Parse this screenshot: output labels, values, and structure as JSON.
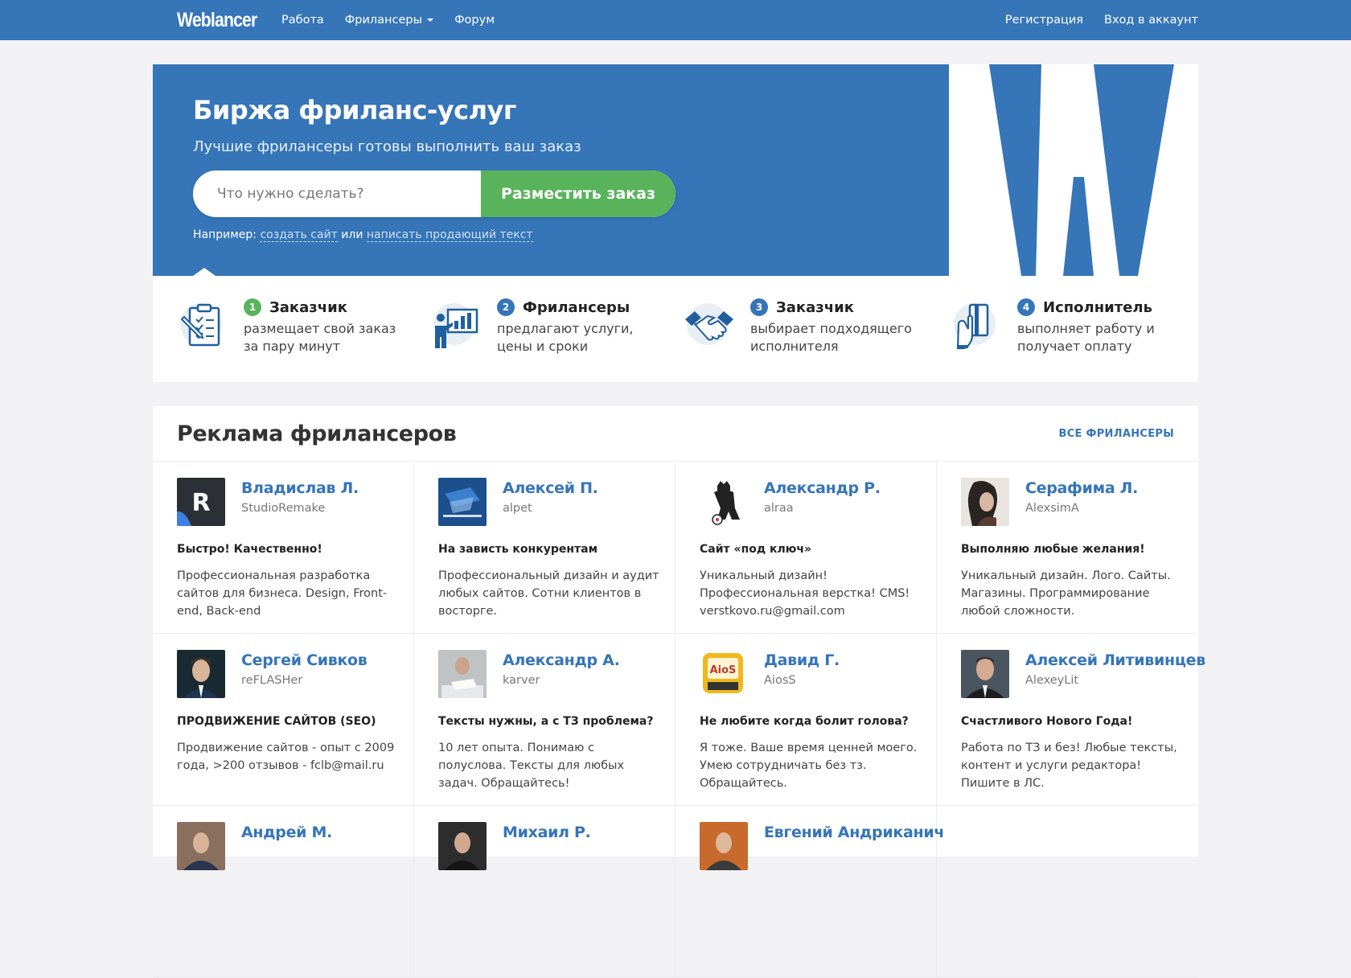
{
  "nav": {
    "logo": "Weblancer",
    "links": [
      "Работа",
      "Фрилансеры",
      "Форум"
    ],
    "register": "Регистрация",
    "login": "Вход в аккаунт"
  },
  "hero": {
    "title": "Биржа фриланс-услуг",
    "subtitle": "Лучшие фрилансеры готовы выполнить ваш заказ",
    "search_placeholder": "Что нужно сделать?",
    "button": "Разместить заказ",
    "example_prefix": "Например:",
    "example_link1": "создать сайт",
    "example_or": "или",
    "example_link2": "написать продающий текст"
  },
  "steps": [
    {
      "num": "1",
      "title": "Заказчик",
      "desc": "размещает свой заказ за пару минут",
      "badge_color": "#58b35a",
      "icon": "checklist-icon"
    },
    {
      "num": "2",
      "title": "Фрилансеры",
      "desc": "предлагают услуги, цены и сроки",
      "badge_color": "#3575b8",
      "icon": "presentation-icon"
    },
    {
      "num": "3",
      "title": "Заказчик",
      "desc": "выбирает подходящего исполнителя",
      "badge_color": "#3575b8",
      "icon": "handshake-icon"
    },
    {
      "num": "4",
      "title": "Исполнитель",
      "desc": "выполняет работу и получает оплату",
      "badge_color": "#3575b8",
      "icon": "card-payment-icon"
    }
  ],
  "ads": {
    "title": "Реклама фрилансеров",
    "all_link": "ВСЕ ФРИЛАНСЕРЫ",
    "cards": [
      {
        "name": "Владислав Л.",
        "login": "StudioRemake",
        "headline": "Быстро! Качественно!",
        "desc": "Профессиональная разработка сайтов для бизнеса. Design, Front-end, Back-end"
      },
      {
        "name": "Алексей П.",
        "login": "alpet",
        "headline": "На зависть конкурентам",
        "desc": "Профессиональный дизайн и аудит любых сайтов. Сотни клиентов в восторге."
      },
      {
        "name": "Александр Р.",
        "login": "alraa",
        "headline": "Сайт «под ключ»",
        "desc": "Уникальный дизайн! Профессиональная верстка! CMS! verstkovo.ru@gmail.com"
      },
      {
        "name": "Серафима Л.",
        "login": "AlexsimA",
        "headline": "Выполняю любые желания!",
        "desc": "Уникальный дизайн. Лого. Сайты. Магазины. Программирование любой сложности."
      },
      {
        "name": "Сергей Сивков",
        "login": "reFLASHer",
        "headline": "ПРОДВИЖЕНИЕ САЙТОВ (SEO)",
        "desc": "Продвижение сайтов - опыт с 2009 года, >200 отзывов - fclb@mail.ru"
      },
      {
        "name": "Александр А.",
        "login": "karver",
        "headline": "Тексты нужны, а с ТЗ проблема?",
        "desc": "10 лет опыта. Понимаю с полуслова. Тексты для любых задач. Обращайтесь!"
      },
      {
        "name": "Давид Г.",
        "login": "AiosS",
        "headline": "Не любите когда болит голова?",
        "desc": "Я тоже. Ваше время ценней моего. Умею сотрудничать без тз. Обращайтесь."
      },
      {
        "name": "Алексей Литивинцев",
        "login": "AlexeyLit",
        "headline": "Счастливого Нового Года!",
        "desc": "Работа по ТЗ и без! Любые тексты, контент и услуги редактора! Пишите в ЛС."
      },
      {
        "name": "Андрей М.",
        "login": "",
        "headline": "",
        "desc": ""
      },
      {
        "name": "Михаил Р.",
        "login": "",
        "headline": "",
        "desc": ""
      },
      {
        "name": "Евгений Андриканич",
        "login": "",
        "headline": "",
        "desc": ""
      }
    ]
  },
  "colors": {
    "brand": "#3575b8",
    "accent_green": "#58b35a"
  }
}
